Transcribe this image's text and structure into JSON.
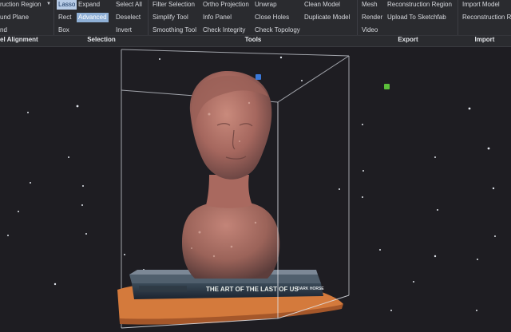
{
  "ribbon": {
    "alignment": {
      "items": [
        "ruction Region",
        "und Plane",
        "nd"
      ],
      "label": "el Alignment"
    },
    "selection": {
      "col1": [
        "Lasso",
        "Rect",
        "Box"
      ],
      "col2": [
        "Expand",
        "Advanced"
      ],
      "col3": [
        "Select All",
        "Deselect",
        "Invert"
      ],
      "label": "Selection"
    },
    "tools": {
      "col1": [
        "Filter Selection",
        "Simplify Tool",
        "Smoothing Tool"
      ],
      "col2": [
        "Ortho Projection",
        "Info Panel",
        "Check Integrity"
      ],
      "col3": [
        "Unwrap",
        "Close Holes",
        "Check Topology"
      ],
      "col4": [
        "Clean Model",
        "Duplicate Model"
      ],
      "label": "Tools"
    },
    "export": {
      "col1": [
        "Mesh",
        "Render",
        "Video"
      ],
      "col2": [
        "Reconstruction Region",
        "Upload To Sketchfab"
      ],
      "label": "Export"
    },
    "import": {
      "col1": [
        "Import Model",
        "Reconstruction R"
      ],
      "label": "Import"
    }
  },
  "viewport": {
    "book_title": "THE ART OF THE LAST OF US",
    "book_publisher": "DARK HORSE",
    "icon_colors": {
      "blue": "#3a78d8",
      "green": "#5bbf3a"
    }
  }
}
